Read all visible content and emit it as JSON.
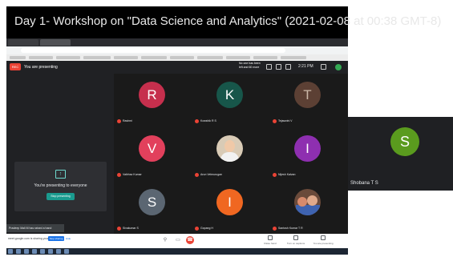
{
  "video_title": "Day 1- Workshop on \"Data Science and Analytics\" (2021-02-08 at 00:38 GMT-8)",
  "meet": {
    "rec_label": "REC",
    "presenting_banner": "You are presenting",
    "clock": "2:21 PM",
    "notification": "No one has been left and 60 more",
    "present_message": "You're presenting to everyone",
    "stop_presenting_label": "Stop presenting",
    "raised_hand_note": "Pradeep Mali M has raised a hand",
    "bottom_hint": "meet.google.com is sharing your screen",
    "bottom_stop_label": "Stop sharing",
    "bottom_hide_label": "Hide",
    "options": [
      {
        "label": "Raise hand"
      },
      {
        "label": "Turn on captions"
      },
      {
        "label": "You are presenting"
      }
    ]
  },
  "participants": [
    {
      "initial": "R",
      "name": "Rashmi",
      "color": "#c62f4d"
    },
    {
      "initial": "K",
      "name": "Kowshik R S",
      "color": "#17564a"
    },
    {
      "initial": "T",
      "name": "Tejaswini V",
      "color": "#5c4034"
    },
    {
      "initial": "V",
      "name": "Vaibhav Kumar",
      "color": "#e2405c"
    },
    {
      "initial": "",
      "name": "Arun Velmurugan",
      "color": "#d9cbb6"
    },
    {
      "initial": "I",
      "name": "Nijesh Kalvan",
      "color": "#8e2fb0"
    },
    {
      "initial": "S",
      "name": "Sivakumar S",
      "color": "#5b6672"
    },
    {
      "initial": "I",
      "name": "Gopang H",
      "color": "#f06721"
    },
    {
      "initial": "",
      "name": "Santosh Kumar T R",
      "color": "#6a4a3a"
    }
  ],
  "side_participant": {
    "initial": "S",
    "name": "Shobana T S",
    "color": "#5a9b1e"
  }
}
